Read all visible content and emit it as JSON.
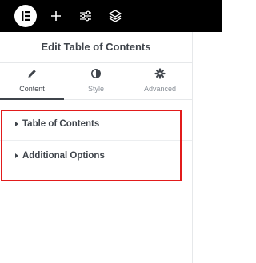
{
  "topbar": {
    "icons": [
      "elementor-logo-icon",
      "plus-icon",
      "sliders-icon",
      "layers-icon"
    ],
    "background": "#000000"
  },
  "panel": {
    "title": "Edit Table of Contents",
    "tabs": [
      {
        "label": "Content",
        "icon": "pencil-icon",
        "active": true
      },
      {
        "label": "Style",
        "icon": "half-circle-icon",
        "active": false
      },
      {
        "label": "Advanced",
        "icon": "gear-icon",
        "active": false
      }
    ],
    "sections": [
      {
        "label": "Table of Contents",
        "icon": "caret-right-icon"
      },
      {
        "label": "Additional Options",
        "icon": "caret-right-icon"
      }
    ]
  },
  "colors": {
    "text": "#3f444b",
    "muted": "#8a9098",
    "highlight": "#e21b1b"
  }
}
